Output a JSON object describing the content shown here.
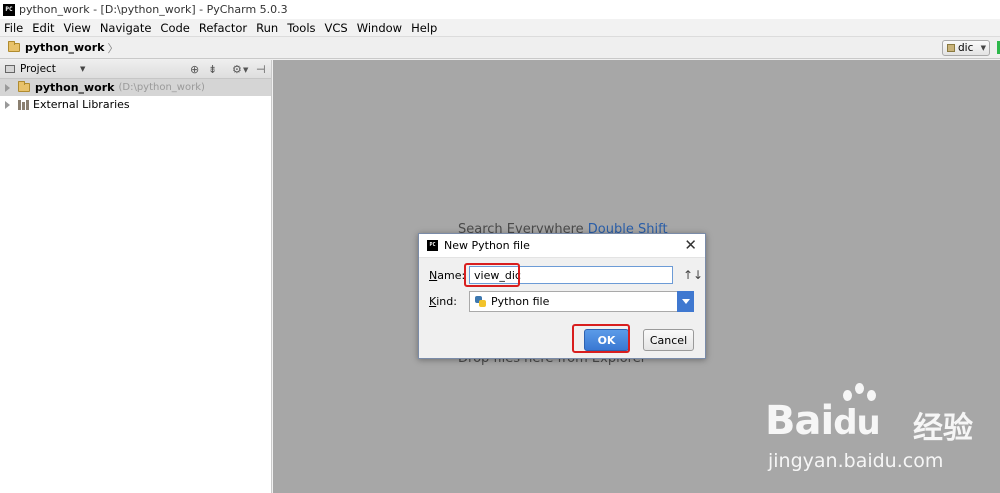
{
  "window": {
    "title": "python_work - [D:\\python_work] - PyCharm 5.0.3",
    "logo": "PC"
  },
  "menu": [
    "File",
    "Edit",
    "View",
    "Navigate",
    "Code",
    "Refactor",
    "Run",
    "Tools",
    "VCS",
    "Window",
    "Help"
  ],
  "navbar": {
    "project": "python_work",
    "chevron": "〉",
    "run_config": "dic"
  },
  "sidebar": {
    "header_label": "Project",
    "tree": [
      {
        "name": "python_work",
        "path": "(D:\\python_work)"
      },
      {
        "name": "External Libraries"
      }
    ]
  },
  "editor": {
    "hint_search_prefix": "Search Everywhere ",
    "hint_search_key": "Double Shift",
    "hint_drop": "Drop files here from Explorer"
  },
  "dialog": {
    "title": "New Python file",
    "name_label_u": "N",
    "name_label_rest": "ame:",
    "name_value": "view_dic",
    "kind_label_u": "K",
    "kind_label_rest": "ind:",
    "kind_value": "Python file",
    "ok_label": "OK",
    "cancel_label": "Cancel",
    "close_glyph": "✕",
    "sort_glyph": "↑↓"
  },
  "watermark": {
    "brand": "Bai",
    "brand2": "du",
    "cn": "经验",
    "url": "jingyan.baidu.com"
  },
  "colors": {
    "editor_bg": "#a7a7a7",
    "highlight": "#d81e1e",
    "ok_button": "#3a78d2"
  }
}
